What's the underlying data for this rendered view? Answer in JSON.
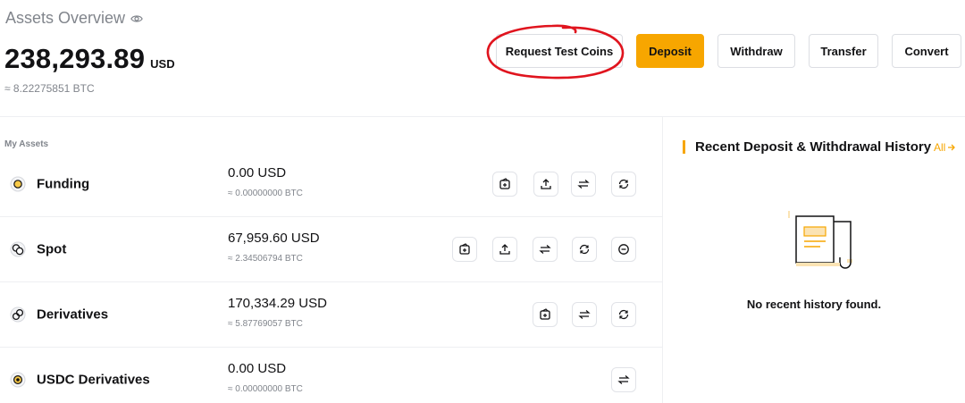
{
  "header": {
    "title": "Assets Overview",
    "total_balance": "238,293.89",
    "balance_unit": "USD",
    "balance_btc": "≈ 8.22275851 BTC"
  },
  "actions": {
    "request_test_coins": "Request Test Coins",
    "deposit": "Deposit",
    "withdraw": "Withdraw",
    "transfer": "Transfer",
    "convert": "Convert"
  },
  "assets": {
    "section_label": "My Assets",
    "rows": [
      {
        "name": "Funding",
        "usd": "0.00 USD",
        "btc": "≈ 0.00000000 BTC",
        "icon": "funding-coin-icon"
      },
      {
        "name": "Spot",
        "usd": "67,959.60 USD",
        "btc": "≈ 2.34506794 BTC",
        "icon": "spot-coins-icon"
      },
      {
        "name": "Derivatives",
        "usd": "170,334.29 USD",
        "btc": "≈ 5.87769057 BTC",
        "icon": "derivatives-rings-icon"
      },
      {
        "name": "USDC Derivatives",
        "usd": "0.00 USD",
        "btc": "≈ 0.00000000 BTC",
        "icon": "usdc-coin-icon"
      }
    ]
  },
  "history": {
    "title": "Recent Deposit & Withdrawal History",
    "all_link": "All",
    "empty_text": "No recent history found."
  },
  "colors": {
    "accent": "#f7a600",
    "annotation": "#e0141e",
    "muted_text": "#81858c"
  }
}
